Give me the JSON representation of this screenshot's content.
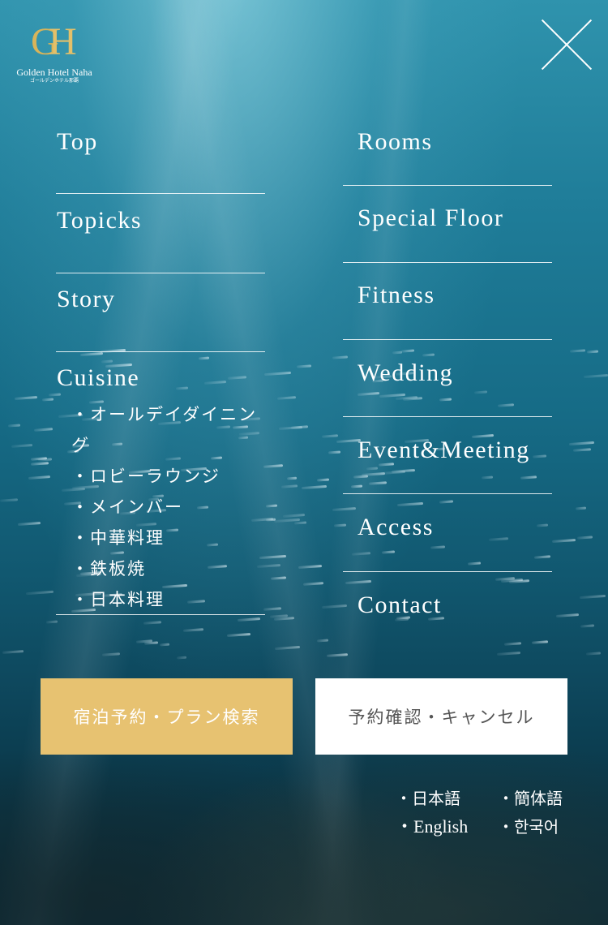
{
  "brand": {
    "logo_letters_g": "G",
    "logo_letters_h": "H",
    "name": "Golden Hotel Naha",
    "name_jp": "ゴールデンホテル那覇"
  },
  "menu": {
    "left": [
      {
        "label": "Top"
      },
      {
        "label": "Topicks"
      },
      {
        "label": "Story"
      },
      {
        "label": "Cuisine"
      }
    ],
    "cuisine_sub": [
      "・オールデイダイニング",
      "・ロビーラウンジ",
      "・メインバー",
      "・中華料理",
      "・鉄板焼",
      "・日本料理"
    ],
    "right": [
      {
        "label": "Rooms"
      },
      {
        "label": "Special Floor"
      },
      {
        "label": "Fitness"
      },
      {
        "label": "Wedding"
      },
      {
        "label": "Event&Meeting"
      },
      {
        "label": "Access"
      },
      {
        "label": "Contact"
      }
    ]
  },
  "buttons": {
    "reserve": "宿泊予約・プラン検索",
    "confirm": "予約確認・キャンセル"
  },
  "languages": {
    "japanese": "・日本語",
    "simplified_chinese": "・簡体語",
    "english": "・English",
    "korean": "・한국어"
  },
  "colors": {
    "reserve_button": "#e7c271",
    "confirm_button": "#ffffff",
    "logo_gold": "#d8b45a"
  }
}
